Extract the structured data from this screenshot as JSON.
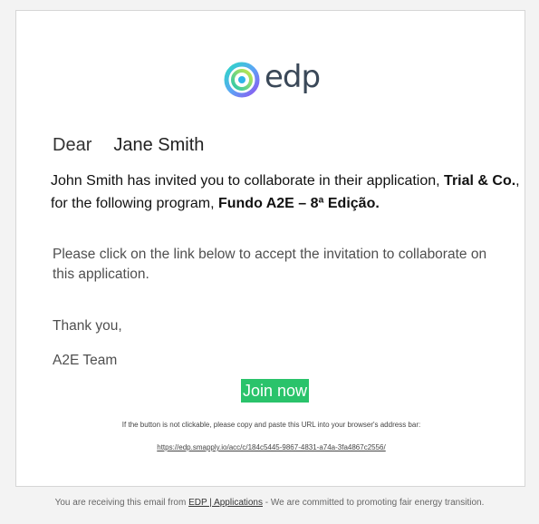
{
  "logo": {
    "text": "edp",
    "icon": "edp-swirl-logo-icon"
  },
  "greeting": {
    "salutation": "Dear",
    "recipient": "Jane Smith"
  },
  "invite": {
    "lead": "John Smith has invited you to collaborate in their application,",
    "application": "Trial & Co.",
    "middle": ", for the following program,",
    "program": "Fundo A2E – 8ª Edição."
  },
  "body": {
    "instruction": "Please click on the link below to accept the invitation to collaborate on this application.",
    "thanks": "Thank you,",
    "signature": "A2E Team"
  },
  "cta": {
    "label": "Join now",
    "color": "#2ac36b"
  },
  "fallback": {
    "note": "If the button is not clickable, please copy and paste this URL into your browser's address bar:",
    "url": "https://edp.smapply.io/acc/c/184c5445-9867-4831-a74a-3fa4867c2556/"
  },
  "footer": {
    "prefix": "You are receiving this email from",
    "link": "EDP | Applications",
    "suffix": "- We are committed to promoting fair energy transition."
  }
}
